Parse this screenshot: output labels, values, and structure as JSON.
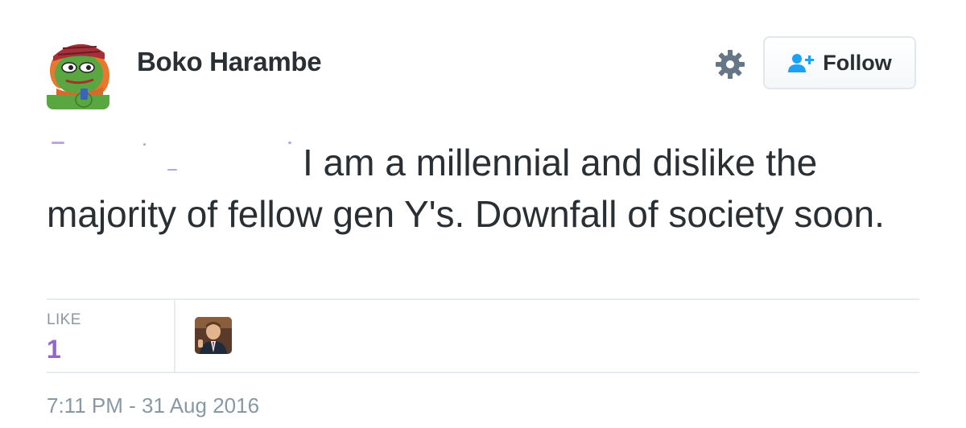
{
  "author": {
    "display_name": "Boko Harambe",
    "avatar_icon": "pepe-frog-avatar-icon"
  },
  "actions": {
    "settings_icon": "gear-icon",
    "follow_label": "Follow",
    "follow_icon": "person-add-icon"
  },
  "tweet": {
    "text_line": "I am a millennial and dislike the majority of fellow gen Y's. Downfall of society soon."
  },
  "stats": {
    "like_label": "LIKE",
    "like_count": "1"
  },
  "timestamp": "7:11 PM - 31 Aug 2016",
  "colors": {
    "like_count": "#9266cc",
    "muted_text": "#8899a6",
    "primary_text": "#292f33",
    "follow_icon": "#1da1f2"
  }
}
